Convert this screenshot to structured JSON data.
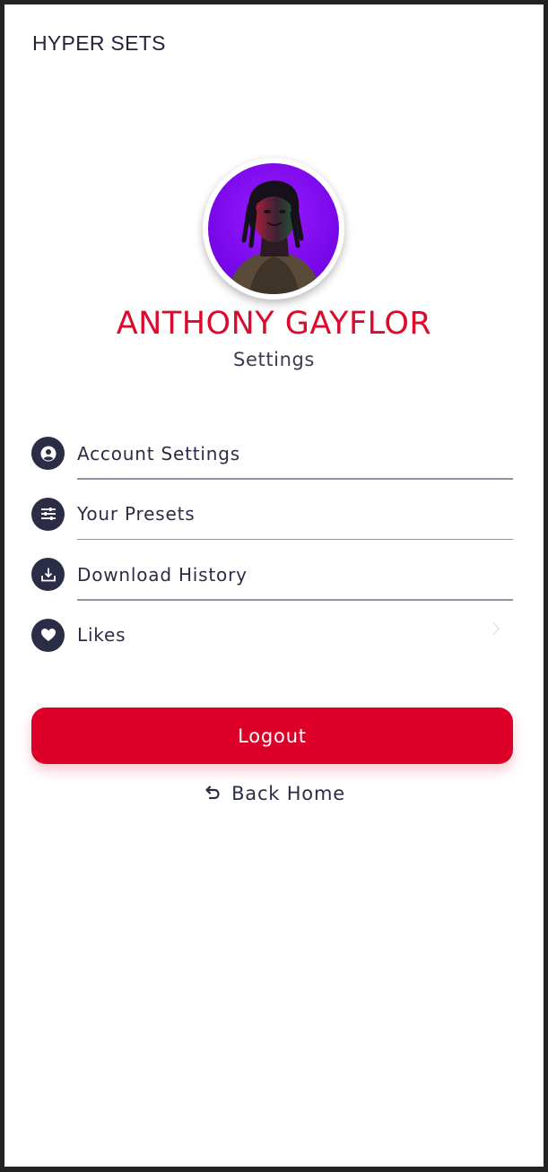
{
  "app": {
    "title": "HYPER SETS"
  },
  "profile": {
    "name": "ANTHONY GAYFLOR",
    "subtitle": "Settings",
    "avatar_alt": "user-avatar-photo"
  },
  "menu": {
    "items": [
      {
        "label": "Account Settings",
        "icon": "user-circle-icon"
      },
      {
        "label": "Your Presets",
        "icon": "sliders-icon"
      },
      {
        "label": "Download History",
        "icon": "download-icon"
      },
      {
        "label": "Likes",
        "icon": "heart-icon"
      }
    ]
  },
  "actions": {
    "logout_label": "Logout",
    "back_home_label": "Back Home"
  },
  "colors": {
    "accent": "#dc0028",
    "name": "#dc0a2d",
    "icon_bg": "#2a2d45",
    "text": "#2a2d45",
    "divider": "#8c96a3"
  }
}
